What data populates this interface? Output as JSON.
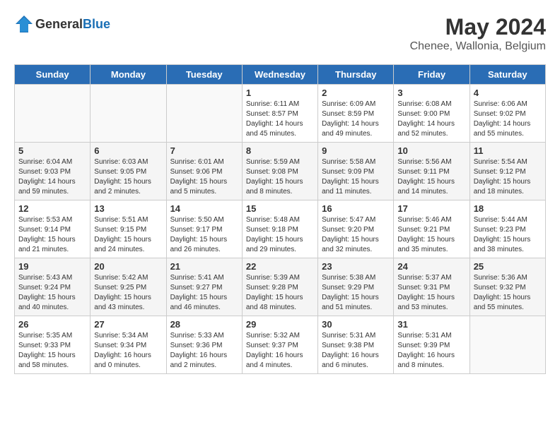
{
  "header": {
    "logo": {
      "general": "General",
      "blue": "Blue"
    },
    "title": "May 2024",
    "location": "Chenee, Wallonia, Belgium"
  },
  "days_of_week": [
    "Sunday",
    "Monday",
    "Tuesday",
    "Wednesday",
    "Thursday",
    "Friday",
    "Saturday"
  ],
  "weeks": [
    [
      {
        "day": "",
        "info": ""
      },
      {
        "day": "",
        "info": ""
      },
      {
        "day": "",
        "info": ""
      },
      {
        "day": "1",
        "info": "Sunrise: 6:11 AM\nSunset: 8:57 PM\nDaylight: 14 hours\nand 45 minutes."
      },
      {
        "day": "2",
        "info": "Sunrise: 6:09 AM\nSunset: 8:59 PM\nDaylight: 14 hours\nand 49 minutes."
      },
      {
        "day": "3",
        "info": "Sunrise: 6:08 AM\nSunset: 9:00 PM\nDaylight: 14 hours\nand 52 minutes."
      },
      {
        "day": "4",
        "info": "Sunrise: 6:06 AM\nSunset: 9:02 PM\nDaylight: 14 hours\nand 55 minutes."
      }
    ],
    [
      {
        "day": "5",
        "info": "Sunrise: 6:04 AM\nSunset: 9:03 PM\nDaylight: 14 hours\nand 59 minutes."
      },
      {
        "day": "6",
        "info": "Sunrise: 6:03 AM\nSunset: 9:05 PM\nDaylight: 15 hours\nand 2 minutes."
      },
      {
        "day": "7",
        "info": "Sunrise: 6:01 AM\nSunset: 9:06 PM\nDaylight: 15 hours\nand 5 minutes."
      },
      {
        "day": "8",
        "info": "Sunrise: 5:59 AM\nSunset: 9:08 PM\nDaylight: 15 hours\nand 8 minutes."
      },
      {
        "day": "9",
        "info": "Sunrise: 5:58 AM\nSunset: 9:09 PM\nDaylight: 15 hours\nand 11 minutes."
      },
      {
        "day": "10",
        "info": "Sunrise: 5:56 AM\nSunset: 9:11 PM\nDaylight: 15 hours\nand 14 minutes."
      },
      {
        "day": "11",
        "info": "Sunrise: 5:54 AM\nSunset: 9:12 PM\nDaylight: 15 hours\nand 18 minutes."
      }
    ],
    [
      {
        "day": "12",
        "info": "Sunrise: 5:53 AM\nSunset: 9:14 PM\nDaylight: 15 hours\nand 21 minutes."
      },
      {
        "day": "13",
        "info": "Sunrise: 5:51 AM\nSunset: 9:15 PM\nDaylight: 15 hours\nand 24 minutes."
      },
      {
        "day": "14",
        "info": "Sunrise: 5:50 AM\nSunset: 9:17 PM\nDaylight: 15 hours\nand 26 minutes."
      },
      {
        "day": "15",
        "info": "Sunrise: 5:48 AM\nSunset: 9:18 PM\nDaylight: 15 hours\nand 29 minutes."
      },
      {
        "day": "16",
        "info": "Sunrise: 5:47 AM\nSunset: 9:20 PM\nDaylight: 15 hours\nand 32 minutes."
      },
      {
        "day": "17",
        "info": "Sunrise: 5:46 AM\nSunset: 9:21 PM\nDaylight: 15 hours\nand 35 minutes."
      },
      {
        "day": "18",
        "info": "Sunrise: 5:44 AM\nSunset: 9:23 PM\nDaylight: 15 hours\nand 38 minutes."
      }
    ],
    [
      {
        "day": "19",
        "info": "Sunrise: 5:43 AM\nSunset: 9:24 PM\nDaylight: 15 hours\nand 40 minutes."
      },
      {
        "day": "20",
        "info": "Sunrise: 5:42 AM\nSunset: 9:25 PM\nDaylight: 15 hours\nand 43 minutes."
      },
      {
        "day": "21",
        "info": "Sunrise: 5:41 AM\nSunset: 9:27 PM\nDaylight: 15 hours\nand 46 minutes."
      },
      {
        "day": "22",
        "info": "Sunrise: 5:39 AM\nSunset: 9:28 PM\nDaylight: 15 hours\nand 48 minutes."
      },
      {
        "day": "23",
        "info": "Sunrise: 5:38 AM\nSunset: 9:29 PM\nDaylight: 15 hours\nand 51 minutes."
      },
      {
        "day": "24",
        "info": "Sunrise: 5:37 AM\nSunset: 9:31 PM\nDaylight: 15 hours\nand 53 minutes."
      },
      {
        "day": "25",
        "info": "Sunrise: 5:36 AM\nSunset: 9:32 PM\nDaylight: 15 hours\nand 55 minutes."
      }
    ],
    [
      {
        "day": "26",
        "info": "Sunrise: 5:35 AM\nSunset: 9:33 PM\nDaylight: 15 hours\nand 58 minutes."
      },
      {
        "day": "27",
        "info": "Sunrise: 5:34 AM\nSunset: 9:34 PM\nDaylight: 16 hours\nand 0 minutes."
      },
      {
        "day": "28",
        "info": "Sunrise: 5:33 AM\nSunset: 9:36 PM\nDaylight: 16 hours\nand 2 minutes."
      },
      {
        "day": "29",
        "info": "Sunrise: 5:32 AM\nSunset: 9:37 PM\nDaylight: 16 hours\nand 4 minutes."
      },
      {
        "day": "30",
        "info": "Sunrise: 5:31 AM\nSunset: 9:38 PM\nDaylight: 16 hours\nand 6 minutes."
      },
      {
        "day": "31",
        "info": "Sunrise: 5:31 AM\nSunset: 9:39 PM\nDaylight: 16 hours\nand 8 minutes."
      },
      {
        "day": "",
        "info": ""
      }
    ]
  ]
}
